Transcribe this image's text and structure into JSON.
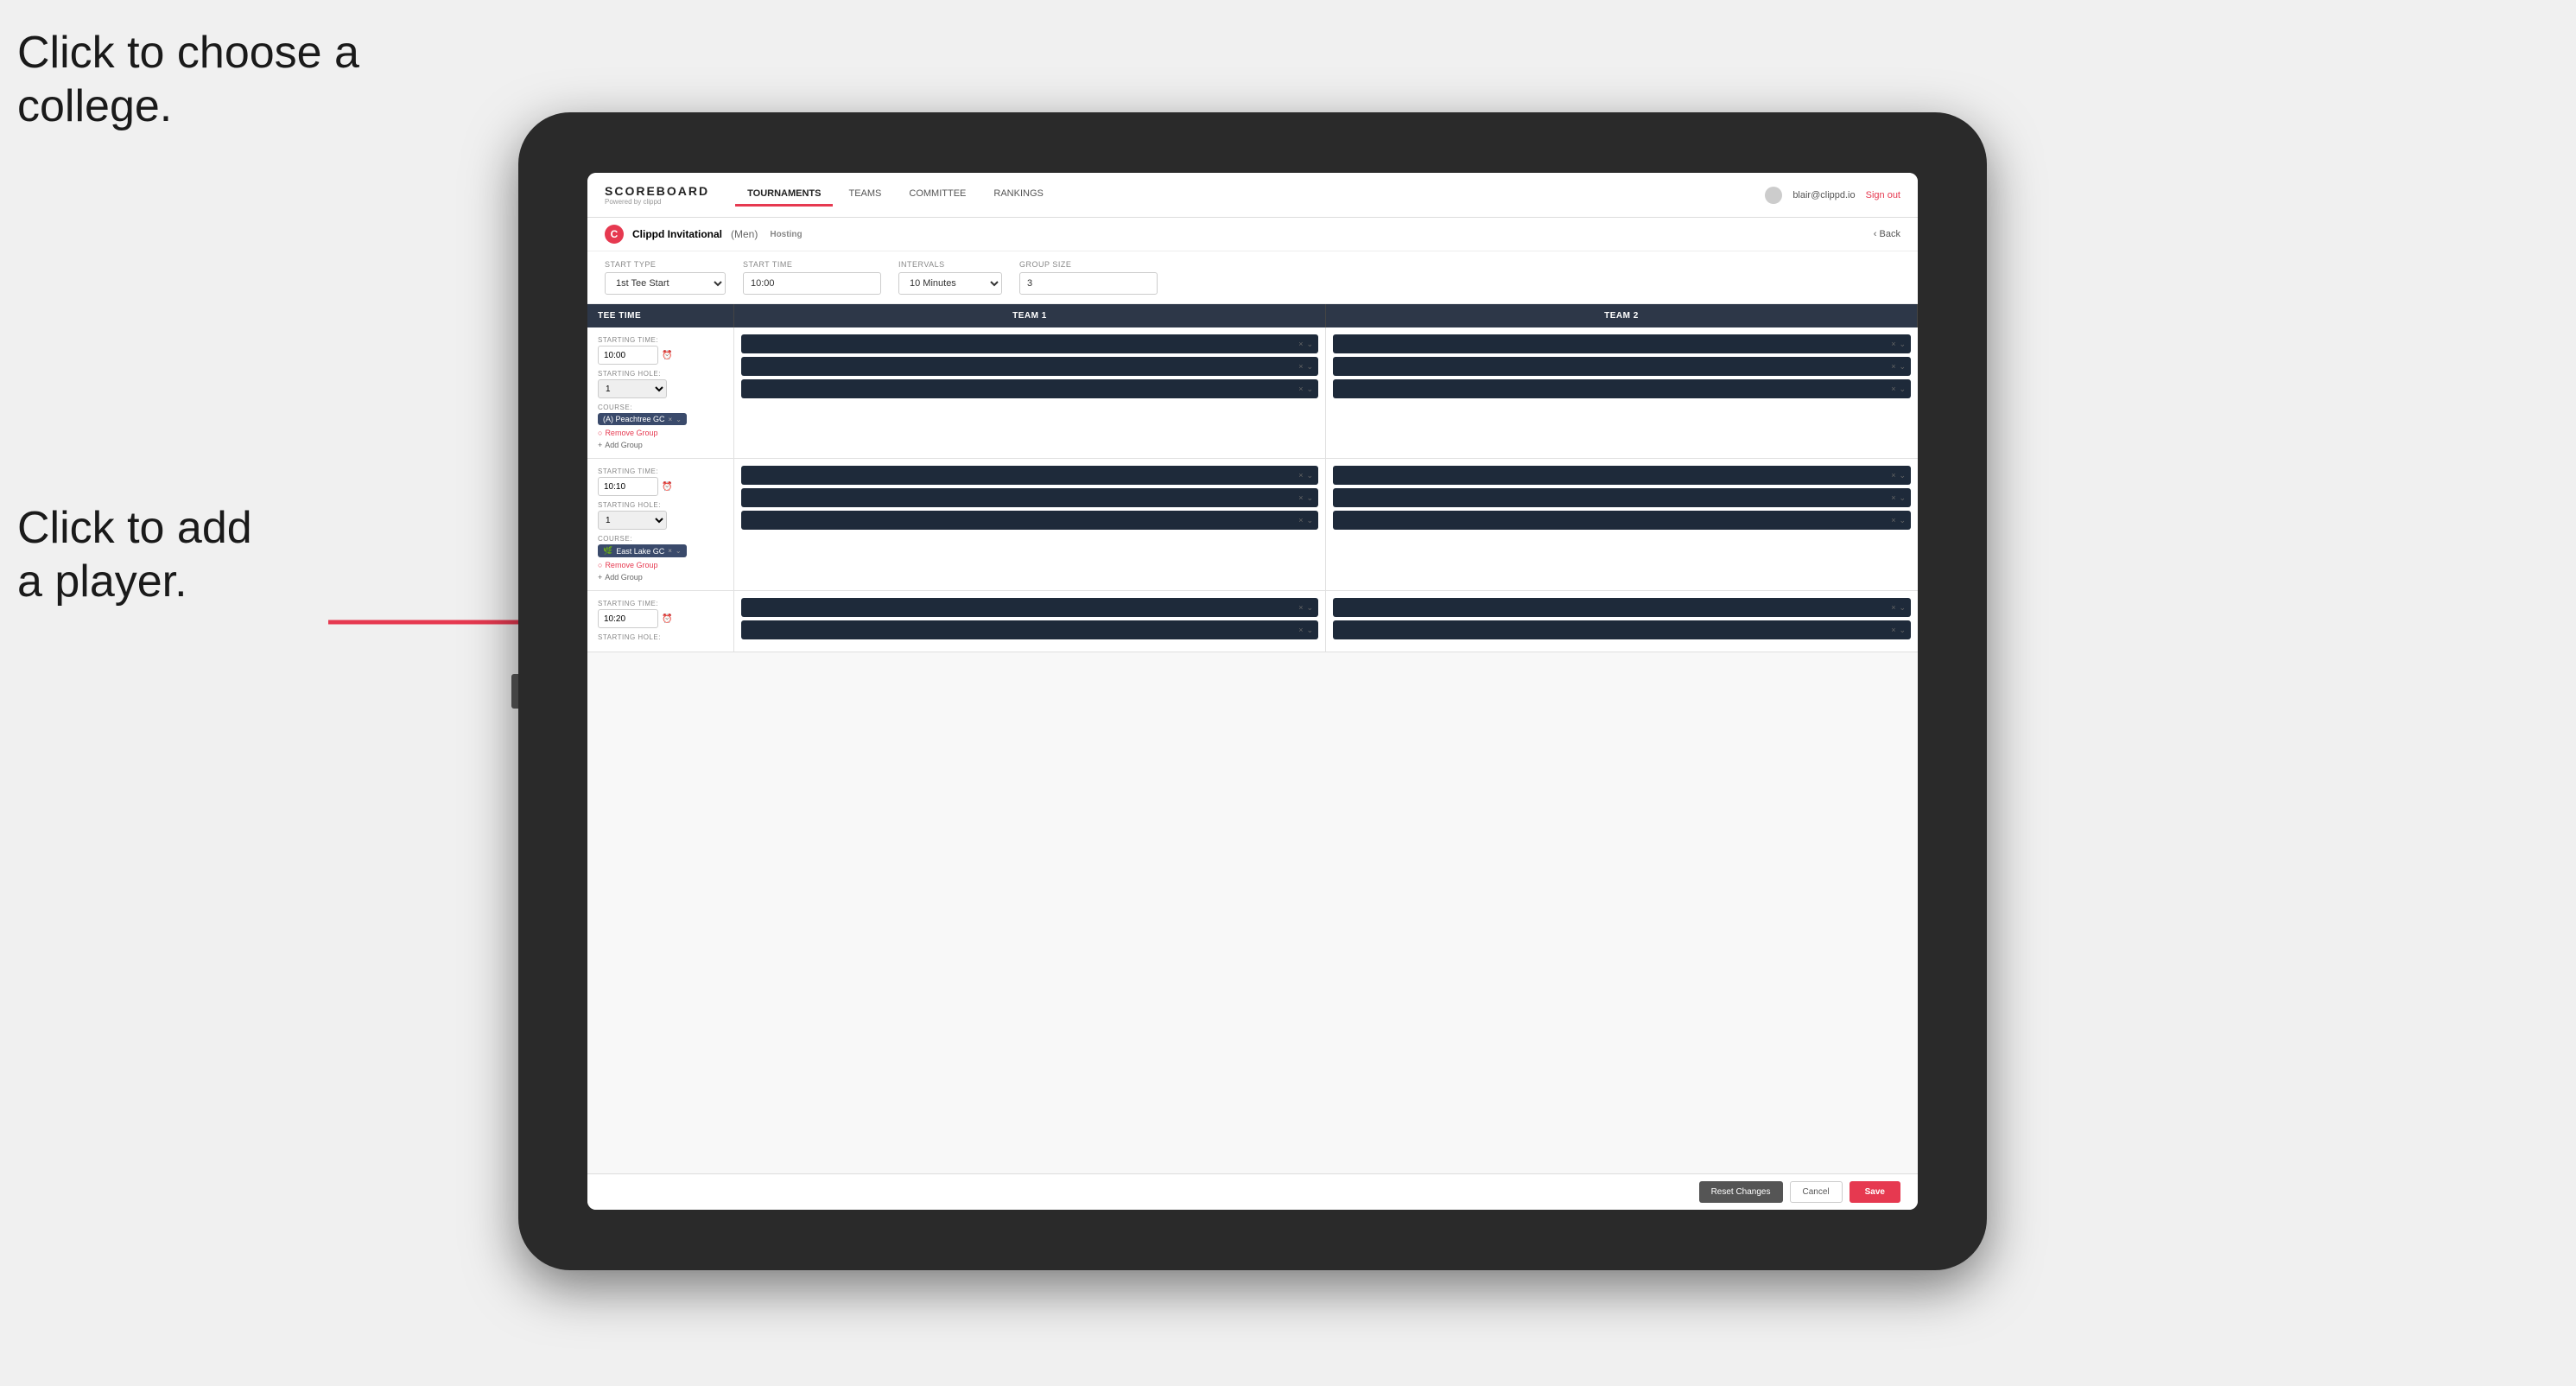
{
  "annotations": {
    "ann1": "Click to choose a\ncollege.",
    "ann2": "Click to add\na player."
  },
  "nav": {
    "brand": "SCOREBOARD",
    "brand_sub": "Powered by clippd",
    "links": [
      "TOURNAMENTS",
      "TEAMS",
      "COMMITTEE",
      "RANKINGS"
    ],
    "active_link": "TOURNAMENTS",
    "user_email": "blair@clippd.io",
    "sign_out": "Sign out"
  },
  "sub_header": {
    "tournament": "Clippd Invitational",
    "gender": "(Men)",
    "status": "Hosting",
    "back": "Back"
  },
  "form": {
    "start_type_label": "Start Type",
    "start_type_value": "1st Tee Start",
    "start_time_label": "Start Time",
    "start_time_value": "10:00",
    "intervals_label": "Intervals",
    "intervals_value": "10 Minutes",
    "group_size_label": "Group Size",
    "group_size_value": "3"
  },
  "table": {
    "col1": "Tee Time",
    "col2": "Team 1",
    "col3": "Team 2"
  },
  "tee_times": [
    {
      "start_time": "10:00",
      "starting_hole": "1",
      "course": "(A) Peachtree GC",
      "slots_team1": 2,
      "slots_team2": 2,
      "has_course_row": true
    },
    {
      "start_time": "10:10",
      "starting_hole": "1",
      "course": "East Lake GC",
      "course_icon": "🌿",
      "slots_team1": 2,
      "slots_team2": 2,
      "has_course_row": true
    },
    {
      "start_time": "10:20",
      "starting_hole": "",
      "course": "",
      "slots_team1": 2,
      "slots_team2": 2,
      "has_course_row": false
    }
  ],
  "buttons": {
    "remove_group": "Remove Group",
    "add_group": "Add Group",
    "reset": "Reset Changes",
    "cancel": "Cancel",
    "save": "Save"
  }
}
